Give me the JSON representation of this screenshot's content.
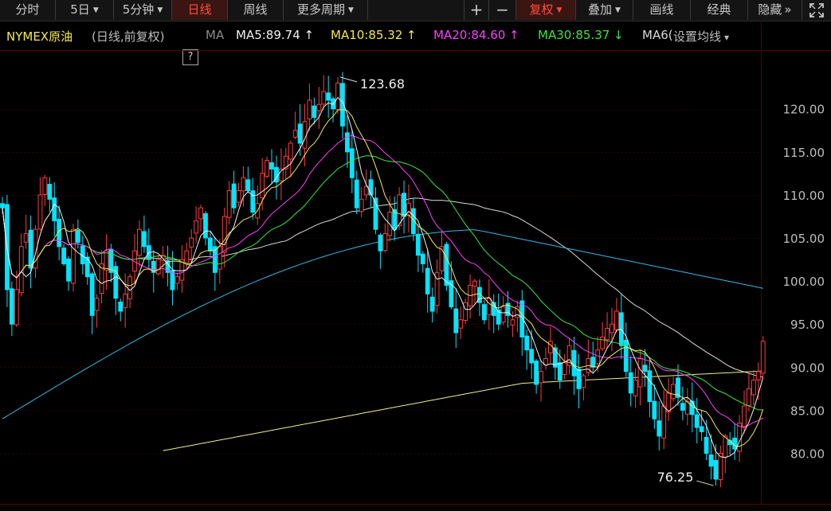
{
  "toolbar": {
    "tabs": [
      {
        "label": "分时"
      },
      {
        "label": "5日"
      },
      {
        "label": "5分钟"
      },
      {
        "label": "日线"
      },
      {
        "label": "周线"
      },
      {
        "label": "更多周期"
      }
    ],
    "active_tab": "日线",
    "plus": "+",
    "minus": "−",
    "fuquan": "复权",
    "diejia": "叠加",
    "huaxian": "画线",
    "jingdian": "经典",
    "yincang": "隐藏",
    "yincang_arrow": "»",
    "expand_icon": "expand-icon"
  },
  "info": {
    "name": "NYMEX原油",
    "subtitle": "(日线,前复权)",
    "help": "?",
    "ma_label": "MA",
    "ma5": "MA5:89.74 ↑",
    "ma10": "MA10:85.32 ↑",
    "ma20": "MA20:84.60 ↑",
    "ma30": "MA30:85.37 ↓",
    "ma60": "MA6(",
    "settings": "设置均线",
    "settings_caret": "▾"
  },
  "colors": {
    "up": "#ff3b3b",
    "down": "#00e5ff",
    "ma5": "#f0f0f0",
    "ma10": "#f5e94a",
    "ma20": "#ff3dff",
    "ma30": "#37e83a",
    "ma60": "#d9d9d9",
    "ma120": "#32b8e8",
    "ma250": "#f0ee8a",
    "grid": "#2e0000",
    "active": "#ff4d3a"
  },
  "chart_data": {
    "type": "candlestick",
    "y_ticks": [
      "120.00",
      "115.00",
      "110.00",
      "105.00",
      "100.00",
      "95.00",
      "90.00",
      "85.00",
      "80.00"
    ],
    "ylim": [
      76.0,
      125.0
    ],
    "annotations": [
      {
        "label": "123.68",
        "value": 123.68,
        "index": 71
      },
      {
        "label": "76.25",
        "value": 76.25,
        "index": 151
      }
    ],
    "ma_current": {
      "MA5": 89.74,
      "MA10": 85.32,
      "MA20": 84.6,
      "MA30": 85.37
    },
    "series": [
      {
        "name": "MA5",
        "close_window": 5
      },
      {
        "name": "MA10",
        "close_window": 10
      },
      {
        "name": "MA20",
        "close_window": 20
      },
      {
        "name": "MA30",
        "close_window": 30
      }
    ],
    "closes": [
      108.5,
      99.0,
      95.0,
      99.0,
      104.0,
      105.5,
      101.5,
      106.0,
      110.0,
      112.0,
      109.5,
      107.0,
      104.0,
      102.0,
      100.0,
      106.0,
      104.5,
      102.0,
      100.5,
      96.0,
      98.0,
      102.0,
      103.5,
      101.0,
      98.0,
      96.5,
      98.5,
      100.5,
      103.5,
      106.0,
      104.0,
      102.5,
      101.0,
      102.5,
      103.0,
      101.0,
      99.0,
      100.5,
      102.5,
      103.5,
      105.0,
      107.0,
      108.5,
      105.0,
      103.5,
      101.0,
      104.0,
      107.5,
      110.5,
      108.5,
      110.5,
      112.0,
      110.5,
      108.0,
      109.0,
      112.5,
      114.0,
      113.0,
      111.5,
      113.0,
      114.5,
      116.0,
      117.5,
      116.0,
      118.5,
      121.0,
      119.0,
      120.5,
      122.0,
      121.0,
      120.0,
      123.0,
      118.0,
      115.0,
      112.0,
      108.5,
      109.5,
      111.0,
      110.0,
      106.0,
      103.5,
      105.5,
      108.0,
      106.0,
      110.0,
      107.5,
      109.0,
      105.5,
      103.0,
      102.0,
      98.5,
      96.5,
      101.0,
      104.0,
      99.5,
      97.0,
      94.0,
      95.5,
      97.5,
      99.5,
      100.0,
      97.5,
      95.5,
      98.0,
      96.0,
      95.0,
      97.0,
      96.0,
      95.5,
      97.0,
      93.5,
      92.0,
      90.5,
      88.0,
      89.5,
      91.0,
      93.0,
      90.0,
      88.5,
      90.5,
      92.5,
      89.0,
      87.5,
      89.0,
      91.0,
      90.0,
      92.0,
      93.5,
      94.5,
      95.0,
      96.5,
      92.5,
      89.5,
      87.0,
      88.5,
      91.0,
      89.5,
      86.0,
      84.0,
      82.0,
      85.5,
      87.0,
      88.0,
      86.5,
      85.0,
      86.0,
      84.5,
      83.0,
      82.5,
      80.0,
      78.5,
      77.0,
      80.0,
      82.0,
      81.0,
      80.5,
      83.5,
      85.5,
      87.5,
      88.5,
      89.5,
      93.0
    ]
  }
}
